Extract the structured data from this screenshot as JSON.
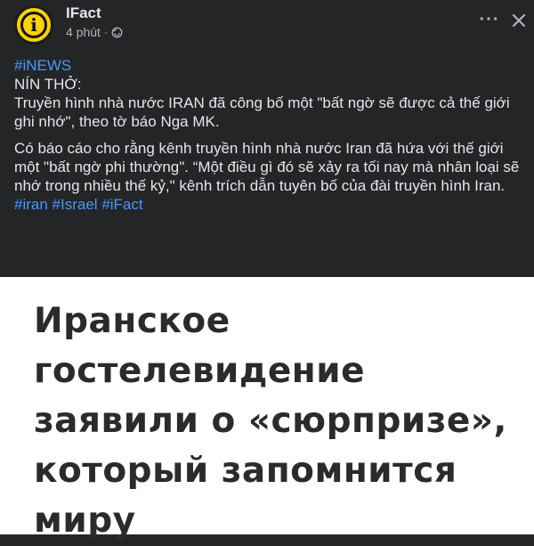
{
  "post": {
    "page_name": "IFact",
    "time": "4 phút",
    "separator": "·",
    "avatar_letter": "i",
    "more_icon": "more-horizontal-icon",
    "close_icon": "close-icon",
    "body": {
      "hashtag_top": "#iNEWS",
      "line_heading": "NÍN THỞ:",
      "para1": "Truyền hình nhà nước IRAN đã công bố một \"bất ngờ sẽ được cả thế giới ghi nhớ\", theo tờ báo Nga MK.",
      "para2": "Có báo cáo cho rằng kênh truyền hình nhà nước Iran đã hứa với thế giới một \"bất ngờ phi thường\". “Một điều gì đó sẽ xảy ra tối nay mà nhân loại sẽ nhớ trong nhiều thế kỷ,\" kênh trích dẫn tuyên bố của đài truyền hình Iran.",
      "hashtags": [
        "#iran",
        "#Israel",
        "#iFact"
      ]
    }
  },
  "image": {
    "headline_lines": [
      "Иранское",
      "гостелевидение",
      "заявили о «сюрпризе»,",
      "который запомнится",
      "миру"
    ]
  },
  "colors": {
    "background": "#242526",
    "text_primary": "#e4e6eb",
    "text_secondary": "#b0b3b8",
    "hashtag": "#4599ff",
    "avatar": "#ffd200"
  }
}
